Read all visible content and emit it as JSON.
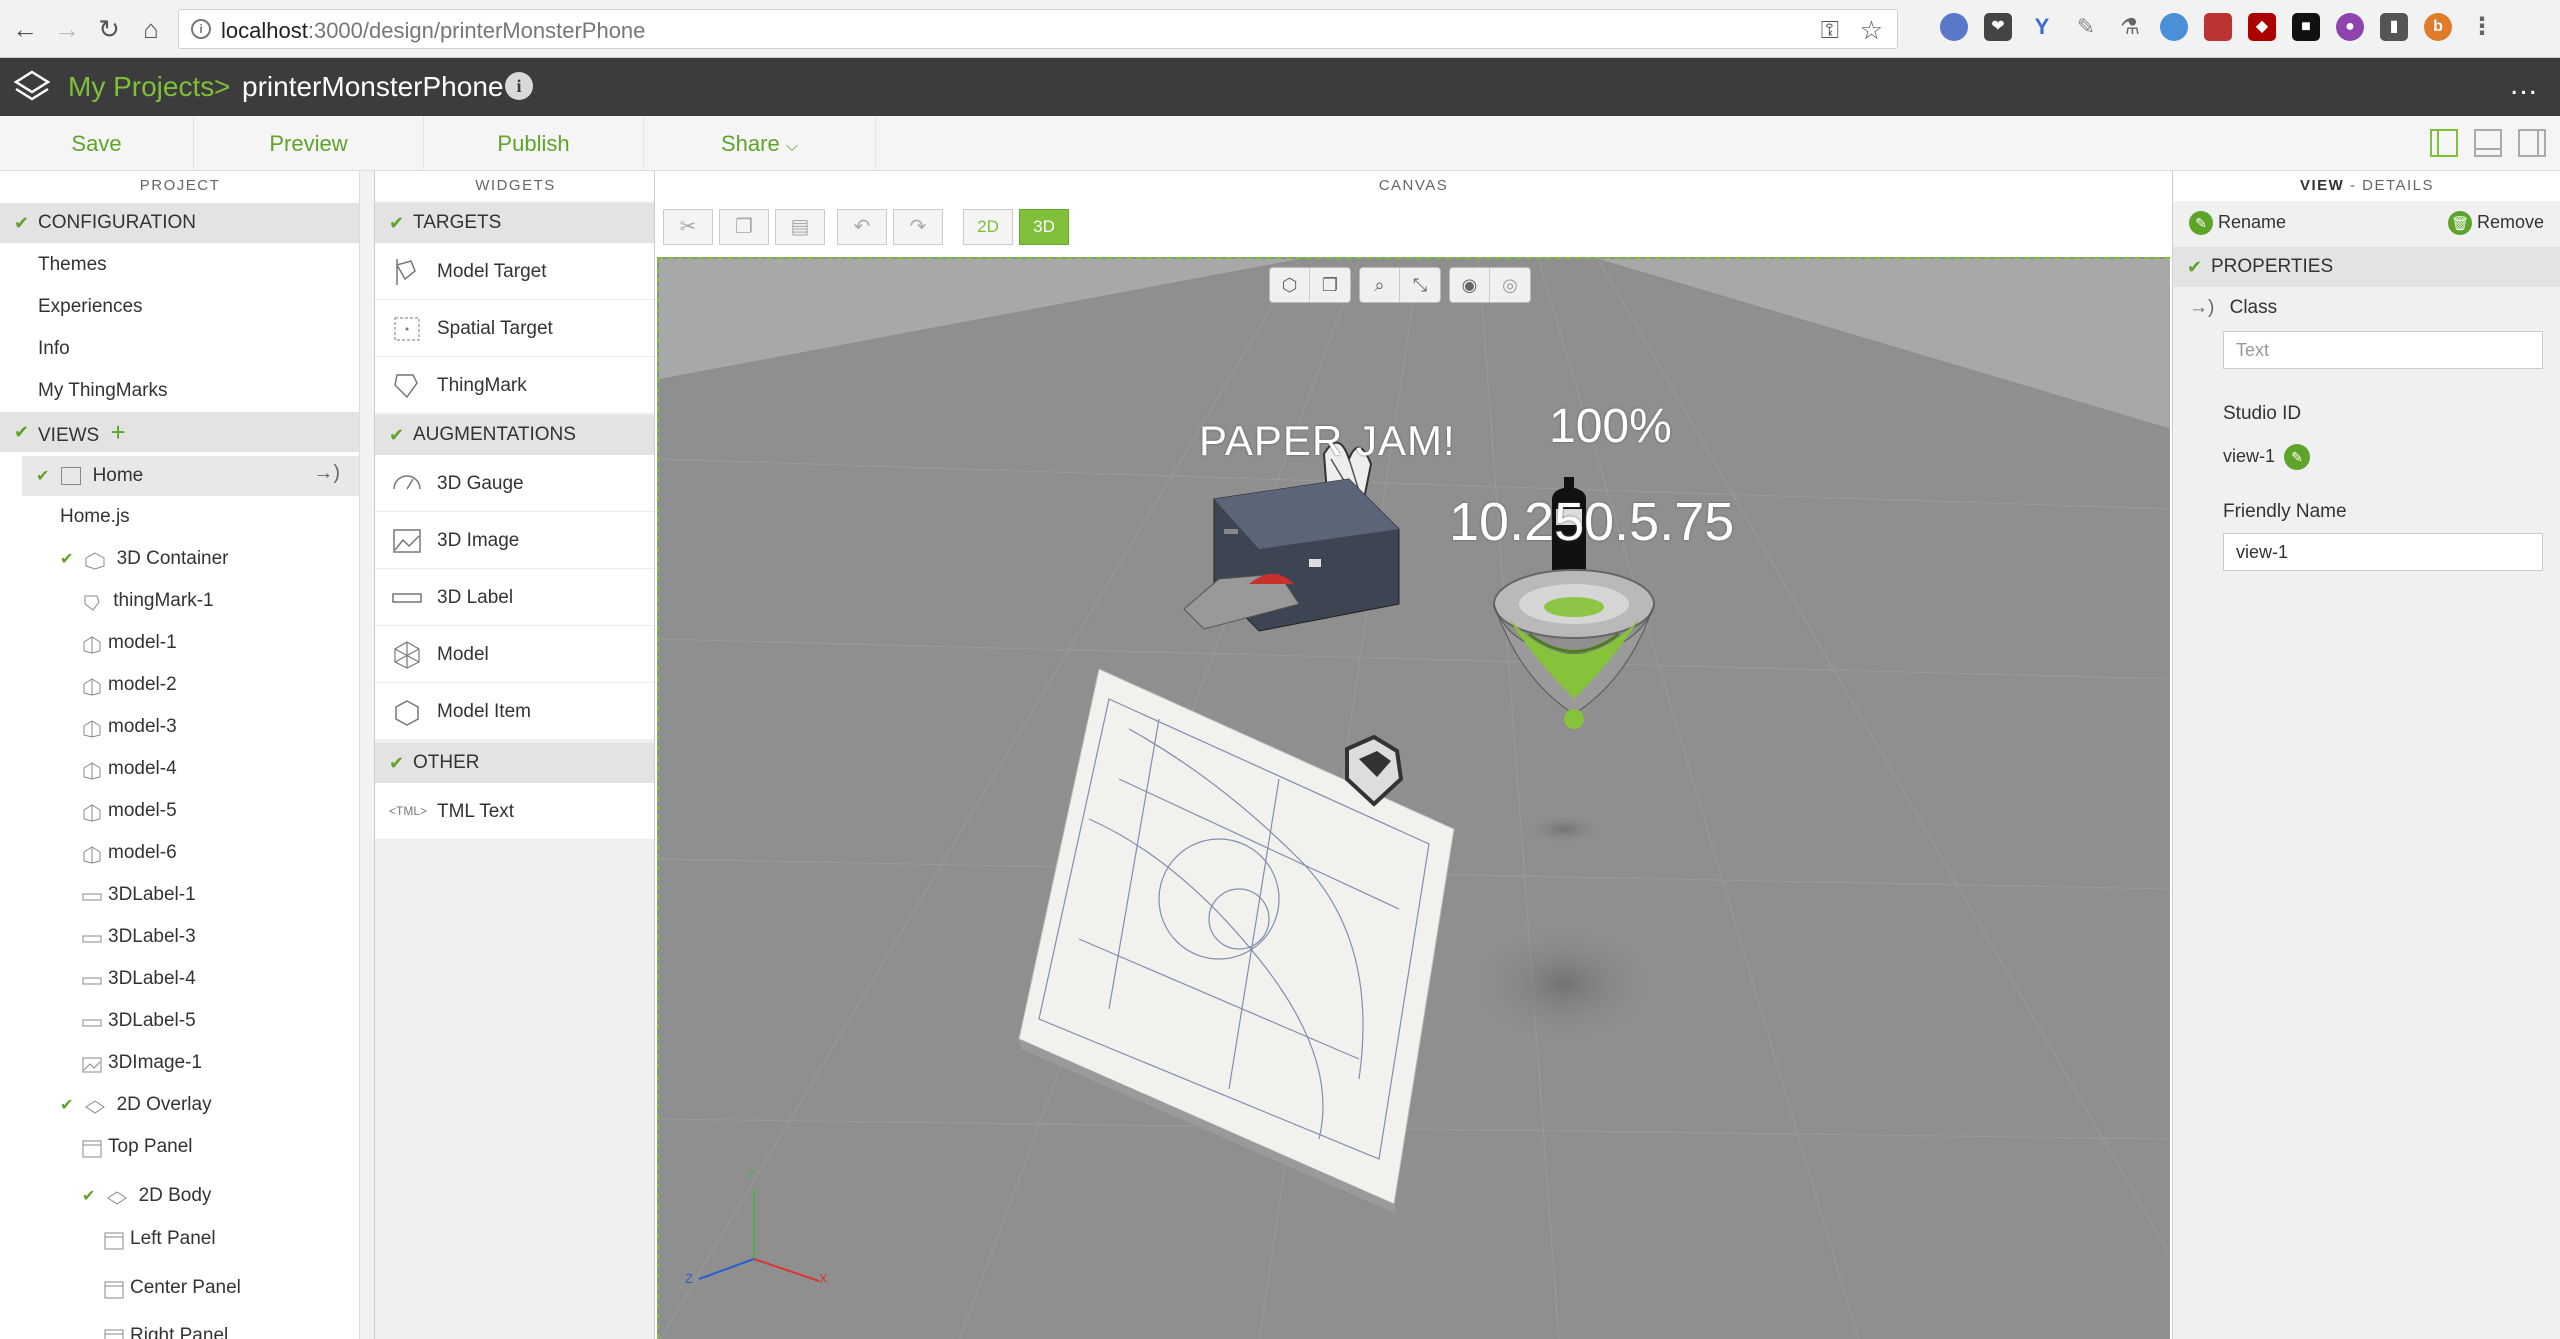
{
  "browser": {
    "url_host": "localhost",
    "url_path": ":3000/design/printerMonsterPhone"
  },
  "header": {
    "projects_link": "My Projects",
    "separator": ">",
    "project_name": "printerMonsterPhone",
    "more": "..."
  },
  "toolbar": {
    "save": "Save",
    "preview": "Preview",
    "publish": "Publish",
    "share": "Share"
  },
  "project_panel": {
    "title": "PROJECT",
    "configuration": {
      "label": "CONFIGURATION",
      "items": [
        "Themes",
        "Experiences",
        "Info",
        "My ThingMarks"
      ]
    },
    "views": {
      "label": "VIEWS",
      "tree": [
        {
          "label": "Home",
          "icon": "view-icon"
        },
        {
          "label": "Home.js",
          "icon": ""
        },
        {
          "label": "3D Container",
          "icon": "container-3d-icon"
        },
        {
          "label": "thingMark-1",
          "icon": "thingmark-icon"
        },
        {
          "label": "model-1",
          "icon": "model-icon"
        },
        {
          "label": "model-2",
          "icon": "model-icon"
        },
        {
          "label": "model-3",
          "icon": "model-icon"
        },
        {
          "label": "model-4",
          "icon": "model-icon"
        },
        {
          "label": "model-5",
          "icon": "model-icon"
        },
        {
          "label": "model-6",
          "icon": "model-icon"
        },
        {
          "label": "3DLabel-1",
          "icon": "label-icon"
        },
        {
          "label": "3DLabel-3",
          "icon": "label-icon"
        },
        {
          "label": "3DLabel-4",
          "icon": "label-icon"
        },
        {
          "label": "3DLabel-5",
          "icon": "label-icon"
        },
        {
          "label": "3DImage-1",
          "icon": "image-icon"
        },
        {
          "label": "2D Overlay",
          "icon": "overlay-icon"
        },
        {
          "label": "Top Panel",
          "icon": "panel-icon"
        },
        {
          "label": "2D Body",
          "icon": "overlay-icon"
        },
        {
          "label": "Left Panel",
          "icon": "panel-icon"
        },
        {
          "label": "Center Panel",
          "icon": "panel-icon"
        },
        {
          "label": "Right Panel",
          "icon": "panel-icon"
        }
      ]
    }
  },
  "widgets_panel": {
    "title": "WIDGETS",
    "targets": {
      "label": "TARGETS",
      "items": [
        "Model Target",
        "Spatial Target",
        "ThingMark"
      ]
    },
    "augmentations": {
      "label": "AUGMENTATIONS",
      "items": [
        "3D Gauge",
        "3D Image",
        "3D Label",
        "Model",
        "Model Item"
      ]
    },
    "other": {
      "label": "OTHER",
      "items": [
        "TML Text"
      ]
    },
    "tml_prefix": "<TML>"
  },
  "canvas": {
    "title": "CANVAS",
    "mode_2d": "2D",
    "mode_3d": "3D",
    "label_paper": "PAPER JAM!",
    "label_percent": "100%",
    "label_ip": "10.250.5.75",
    "axis_x": "X",
    "axis_y": "Y",
    "axis_z": "Z",
    "colors": {
      "floor": "#8e8e8e",
      "accent": "#7fbf3a"
    }
  },
  "details_panel": {
    "title_view": "VIEW",
    "title_details": " - DETAILS",
    "rename": "Rename",
    "remove": "Remove",
    "properties": "PROPERTIES",
    "class_label": "Class",
    "class_placeholder": "Text",
    "studio_id_label": "Studio ID",
    "studio_id_value": "view-1",
    "friendly_name_label": "Friendly Name",
    "friendly_name_value": "view-1"
  }
}
